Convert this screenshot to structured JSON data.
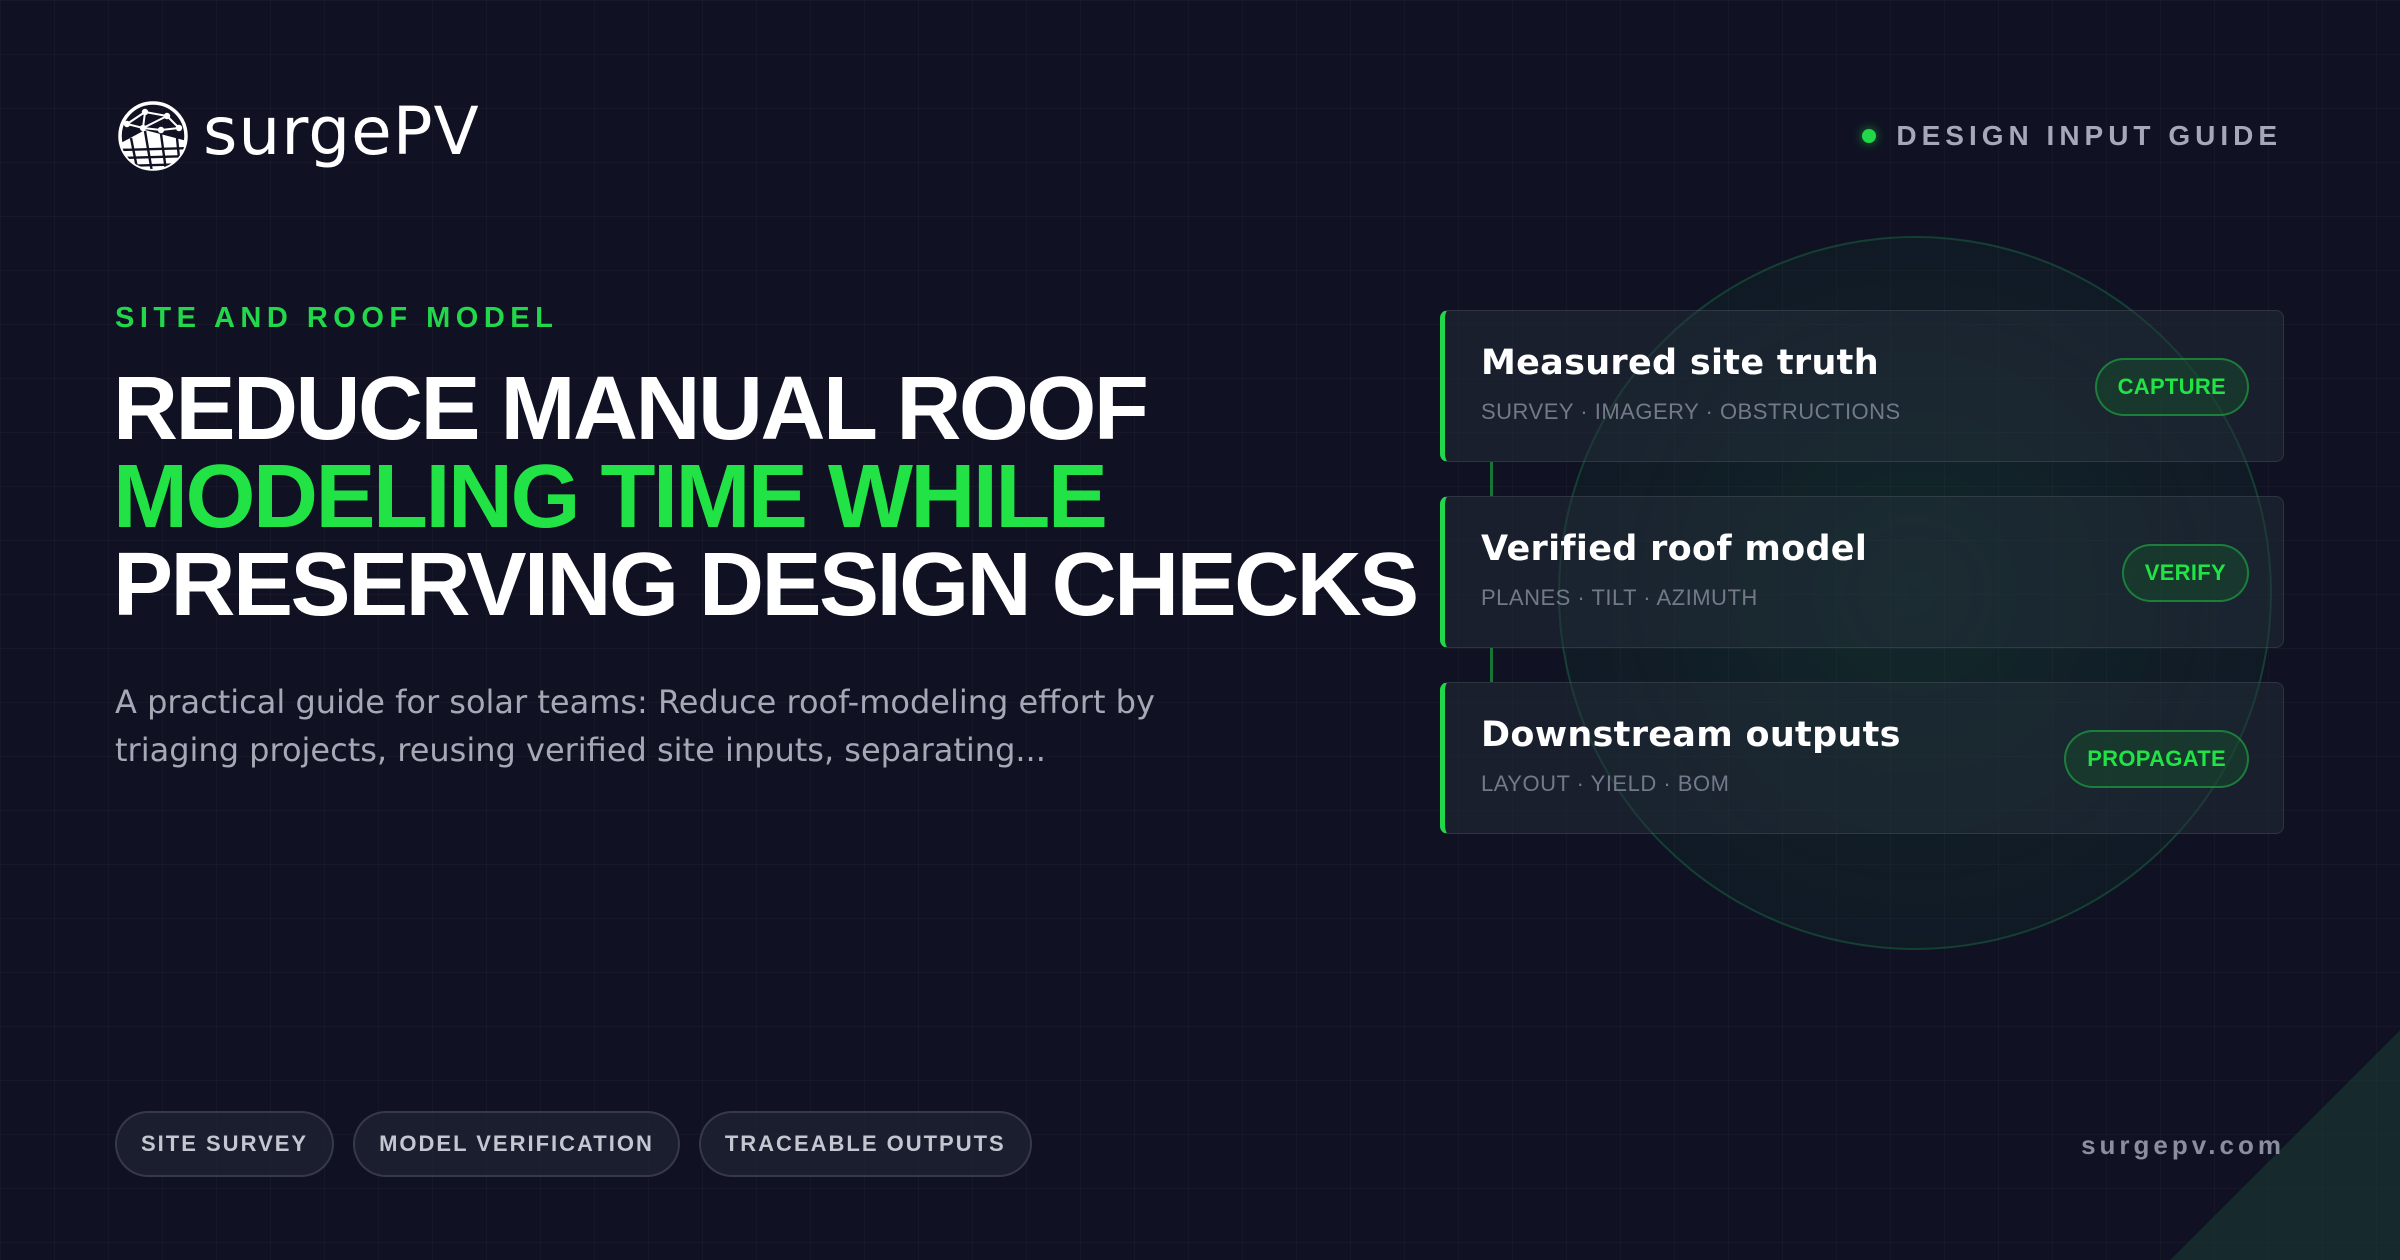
{
  "brand": {
    "name": "surgePV",
    "logo_icon": "globe-solar-panel-icon",
    "url": "surgepv.com"
  },
  "guide_label": {
    "text": "DESIGN INPUT GUIDE",
    "dot_icon": "status-dot-icon"
  },
  "hero": {
    "eyebrow": "SITE AND ROOF MODEL",
    "headline": {
      "line1": "REDUCE MANUAL ROOF",
      "line2": "MODELING TIME WHILE",
      "line3": "PRESERVING DESIGN CHECKS"
    },
    "lede": "A practical guide for solar teams: Reduce roof-modeling effort by triaging projects, reusing verified site inputs, separating..."
  },
  "steps": [
    {
      "title": "Measured site truth",
      "subtitle": "SURVEY · IMAGERY · OBSTRUCTIONS",
      "tag": "CAPTURE"
    },
    {
      "title": "Verified roof model",
      "subtitle": "PLANES · TILT · AZIMUTH",
      "tag": "VERIFY"
    },
    {
      "title": "Downstream outputs",
      "subtitle": "LAYOUT · YIELD · BOM",
      "tag": "PROPAGATE"
    }
  ],
  "pills": [
    "SITE SURVEY",
    "MODEL VERIFICATION",
    "TRACEABLE OUTPUTS"
  ],
  "colors": {
    "background": "#101223",
    "accent_green": "#22e345",
    "muted_text": "#a6a8b6"
  }
}
